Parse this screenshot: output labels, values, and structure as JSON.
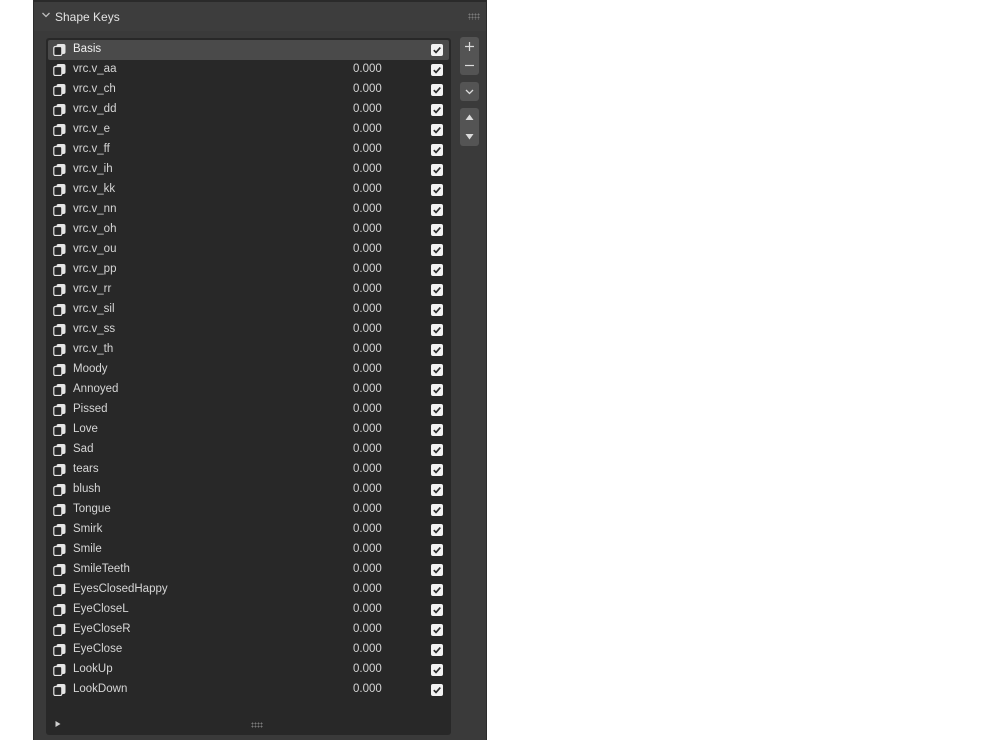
{
  "panel": {
    "title": "Shape Keys",
    "colors": {
      "panel_bg": "#3a3a3a",
      "list_bg": "#282828",
      "active_row_bg": "#4a4a4a",
      "text": "#d6d6d6",
      "checkbox": "#f2f2f2"
    },
    "icons": {
      "collapse": "chevron-down-icon",
      "drag": "grip-dots-icon",
      "key": "shape-key-icon",
      "add": "plus-icon",
      "remove": "minus-icon",
      "specials": "chevron-down-icon",
      "move_up": "triangle-up-icon",
      "move_down": "triangle-down-icon",
      "expand_filter": "triangle-right-icon"
    }
  },
  "shape_keys": [
    {
      "name": "Basis",
      "value": "",
      "enabled": true,
      "active": true
    },
    {
      "name": "vrc.v_aa",
      "value": "0.000",
      "enabled": true
    },
    {
      "name": "vrc.v_ch",
      "value": "0.000",
      "enabled": true
    },
    {
      "name": "vrc.v_dd",
      "value": "0.000",
      "enabled": true
    },
    {
      "name": "vrc.v_e",
      "value": "0.000",
      "enabled": true
    },
    {
      "name": "vrc.v_ff",
      "value": "0.000",
      "enabled": true
    },
    {
      "name": "vrc.v_ih",
      "value": "0.000",
      "enabled": true
    },
    {
      "name": "vrc.v_kk",
      "value": "0.000",
      "enabled": true
    },
    {
      "name": "vrc.v_nn",
      "value": "0.000",
      "enabled": true
    },
    {
      "name": "vrc.v_oh",
      "value": "0.000",
      "enabled": true
    },
    {
      "name": "vrc.v_ou",
      "value": "0.000",
      "enabled": true
    },
    {
      "name": "vrc.v_pp",
      "value": "0.000",
      "enabled": true
    },
    {
      "name": "vrc.v_rr",
      "value": "0.000",
      "enabled": true
    },
    {
      "name": "vrc.v_sil",
      "value": "0.000",
      "enabled": true
    },
    {
      "name": "vrc.v_ss",
      "value": "0.000",
      "enabled": true
    },
    {
      "name": "vrc.v_th",
      "value": "0.000",
      "enabled": true
    },
    {
      "name": "Moody",
      "value": "0.000",
      "enabled": true
    },
    {
      "name": "Annoyed",
      "value": "0.000",
      "enabled": true
    },
    {
      "name": "Pissed",
      "value": "0.000",
      "enabled": true
    },
    {
      "name": "Love",
      "value": "0.000",
      "enabled": true
    },
    {
      "name": "Sad",
      "value": "0.000",
      "enabled": true
    },
    {
      "name": "tears",
      "value": "0.000",
      "enabled": true
    },
    {
      "name": "blush",
      "value": "0.000",
      "enabled": true
    },
    {
      "name": "Tongue",
      "value": "0.000",
      "enabled": true
    },
    {
      "name": "Smirk",
      "value": "0.000",
      "enabled": true
    },
    {
      "name": "Smile",
      "value": "0.000",
      "enabled": true
    },
    {
      "name": "SmileTeeth",
      "value": "0.000",
      "enabled": true
    },
    {
      "name": "EyesClosedHappy",
      "value": "0.000",
      "enabled": true
    },
    {
      "name": "EyeCloseL",
      "value": "0.000",
      "enabled": true
    },
    {
      "name": "EyeCloseR",
      "value": "0.000",
      "enabled": true
    },
    {
      "name": "EyeClose",
      "value": "0.000",
      "enabled": true
    },
    {
      "name": "LookUp",
      "value": "0.000",
      "enabled": true
    },
    {
      "name": "LookDown",
      "value": "0.000",
      "enabled": true
    }
  ]
}
